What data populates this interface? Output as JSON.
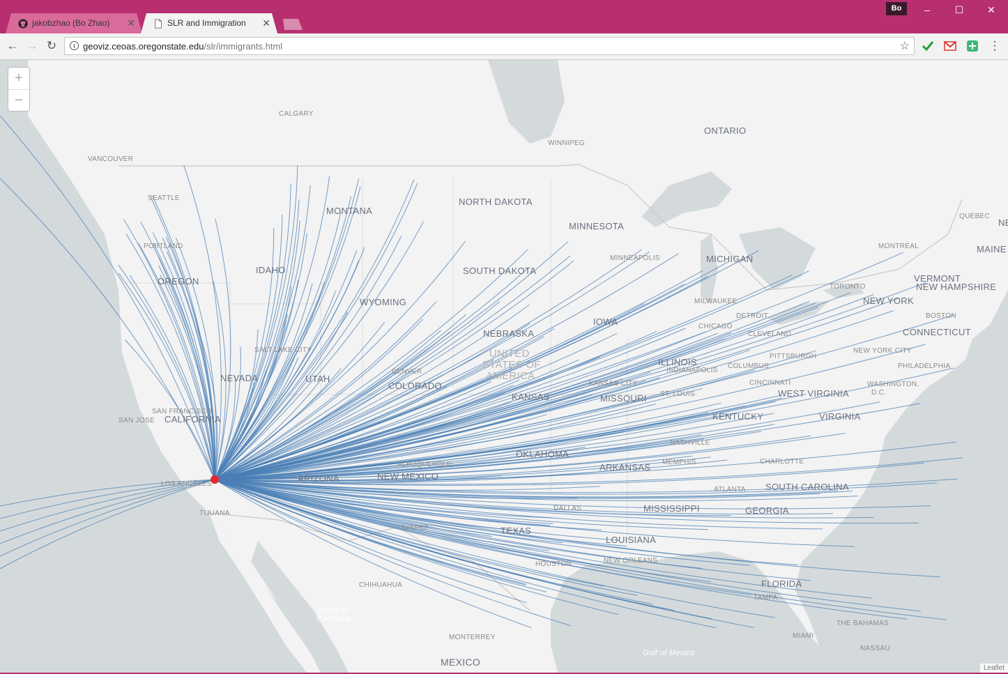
{
  "window": {
    "profile_badge": "Bo",
    "controls": {
      "minimize": "–",
      "maximize": "☐",
      "close": "✕"
    }
  },
  "tabs": [
    {
      "title": "jakobzhao (Bo Zhao)",
      "icon": "github-icon",
      "active": false
    },
    {
      "title": "SLR and Immigration",
      "icon": "page-icon",
      "active": true
    }
  ],
  "toolbar": {
    "url_host": "geoviz.ceoas.oregonstate.edu",
    "url_path": "/slr/immigrants.html",
    "info_glyph": "i",
    "bookmark_glyph": "☆",
    "extensions": [
      "checkmark-extension-icon",
      "gmail-icon",
      "green-extension-icon"
    ],
    "menu_glyph": "⋮"
  },
  "map": {
    "zoom_in": "+",
    "zoom_out": "−",
    "attribution": "Leaflet",
    "origin_marker_color": "#e8262e",
    "flow_line_color": "#4a7fb5",
    "states": [
      "OREGON",
      "IDAHO",
      "MONTANA",
      "WYOMING",
      "NEVADA",
      "UTAH",
      "COLORADO",
      "CALIFORNIA",
      "ARIZONA",
      "NEW MEXICO",
      "NORTH DAKOTA",
      "SOUTH DAKOTA",
      "NEBRASKA",
      "KANSAS",
      "OKLAHOMA",
      "TEXAS",
      "MINNESOTA",
      "IOWA",
      "MISSOURI",
      "ARKANSAS",
      "LOUISIANA",
      "MISSISSIPPI",
      "ILLINOIS",
      "MICHIGAN",
      "KENTUCKY",
      "WEST VIRGINIA",
      "VIRGINIA",
      "SOUTH CAROLINA",
      "GEORGIA",
      "FLORIDA",
      "NEW YORK",
      "CONNECTICUT",
      "VERMONT",
      "NEW HAMPSHIRE",
      "MAINE",
      "ONTARIO",
      "MEXICO",
      "UNITED",
      "STATES OF",
      "AMERICA"
    ],
    "cities": [
      "CALGARY",
      "VANCOUVER",
      "SEATTLE",
      "PORTLAND",
      "SALT LAKE CITY",
      "SAN FRANCISCO",
      "SAN JOSE",
      "LOS ANGELES",
      "TIJUANA",
      "DENVER",
      "ALBUQUERQUE",
      "JUAREZ",
      "CHIHUAHUA",
      "MONTERREY",
      "DALLAS",
      "HOUSTON",
      "NEW ORLEANS",
      "TAMPA",
      "MIAMI",
      "NASSAU",
      "THE BAHAMAS",
      "ATLANTA",
      "CHARLOTTE",
      "MEMPHIS",
      "NASHVILLE",
      "KANSAS CITY",
      "ST. LOUIS",
      "INDIANAPOLIS",
      "CINCINNATI",
      "COLUMBUS",
      "CLEVELAND",
      "PITTSBURGH",
      "DETROIT",
      "CHICAGO",
      "MILWAUKEE",
      "MINNEAPOLIS",
      "WINNIPEG",
      "TORONTO",
      "MONTRÉAL",
      "QUÉBEC",
      "BOSTON",
      "NEW YORK CITY",
      "PHILADELPHIA",
      "WASHINGTON,",
      "D.C.",
      "NE"
    ],
    "water_labels": [
      "Golfo de California",
      "Gulf of Mexico"
    ]
  }
}
